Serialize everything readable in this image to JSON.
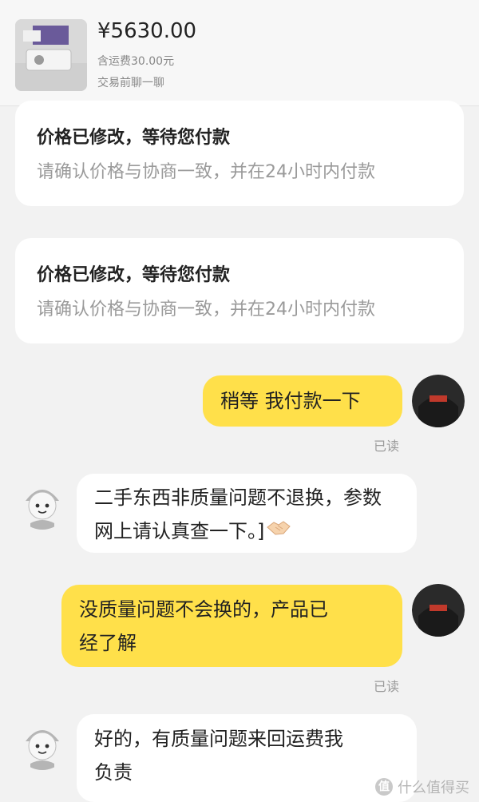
{
  "product": {
    "price": "¥5630.00",
    "shipping": "含运费30.00元",
    "chat_prompt": "交易前聊一聊"
  },
  "notices": [
    {
      "title": "价格已修改，等待您付款",
      "subtitle": "请确认价格与协商一致，并在24小时内付款"
    },
    {
      "title": "价格已修改，等待您付款",
      "subtitle": "请确认价格与协商一致，并在24小时内付款"
    }
  ],
  "messages": [
    {
      "sender": "me",
      "lines": [
        "稍等  我付款一下"
      ],
      "read_status": "已读"
    },
    {
      "sender": "them",
      "lines": [
        "二手东西非质量问题不退换，参数",
        "网上请认真查一下。]"
      ],
      "emoji": "handshake"
    },
    {
      "sender": "me",
      "lines": [
        "没质量问题不会换的，产品已",
        "经了解"
      ],
      "read_status": "已读"
    },
    {
      "sender": "them",
      "lines": [
        "好的，有质量问题来回运费我",
        "负责"
      ]
    }
  ],
  "watermark": {
    "badge": "值",
    "text": "什么值得买"
  },
  "colors": {
    "my_bubble": "#ffe04a",
    "their_bubble": "#ffffff",
    "background": "#f2f2f2"
  }
}
